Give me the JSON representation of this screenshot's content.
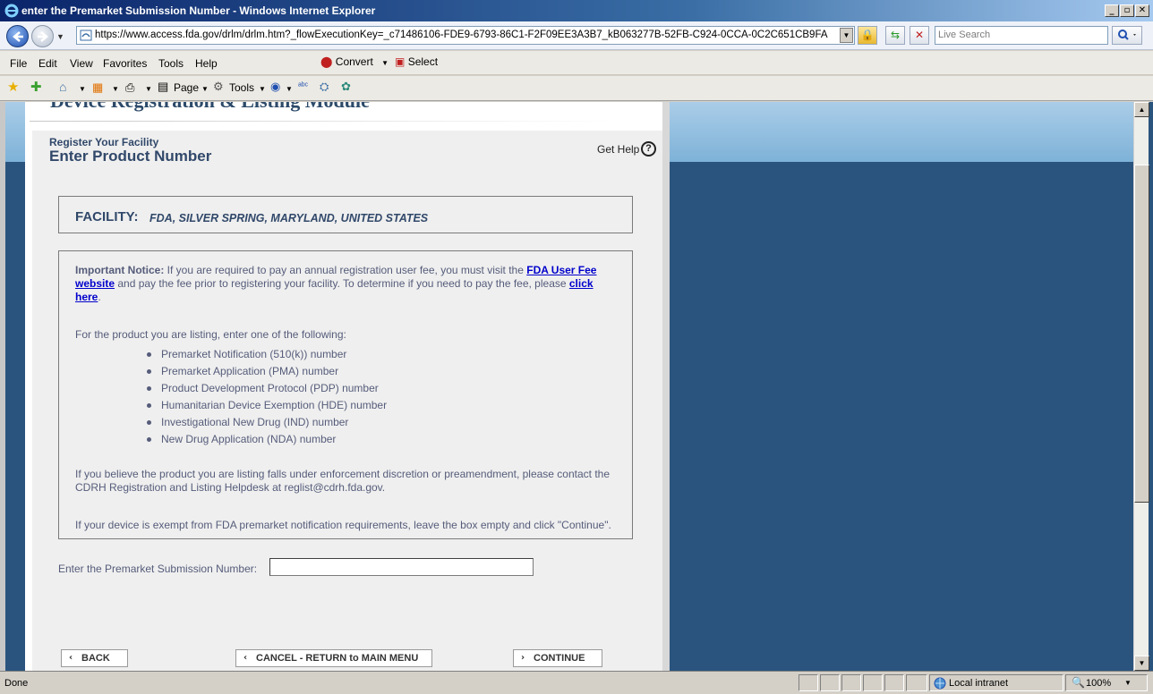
{
  "window": {
    "title": "enter the Premarket Submission Number - Windows Internet Explorer",
    "minimize": "_",
    "maximize": "▫",
    "close": "✕"
  },
  "address_bar": {
    "url": "https://www.access.fda.gov/drlm/drlm.htm?_flowExecutionKey=_c71486106-FDE9-6793-86C1-F2F09EE3A3B7_kB063277B-52FB-C924-0CCA-0C2C651CB9FA",
    "search_placeholder": "Live Search"
  },
  "menu": {
    "items": [
      "File",
      "Edit",
      "View",
      "Favorites",
      "Tools",
      "Help"
    ],
    "convert_label": "Convert",
    "select_label": "Select"
  },
  "command_bar": {
    "page_label": "Page",
    "tools_label": "Tools"
  },
  "page": {
    "cut_header": "Device Registration & Listing Module",
    "breadcrumb": "Register Your Facility",
    "title": "Enter Product Number",
    "get_help": "Get Help",
    "help_icon_glyph": "?",
    "facility": {
      "label": "FACILITY:",
      "value": "FDA, SILVER SPRING, MARYLAND, UNITED STATES"
    },
    "notice": {
      "heading": "Important Notice:",
      "line1_text": " If you are required to pay an annual registration user fee, you must visit the ",
      "user_fee_link_part1": "FDA User Fee",
      "user_fee_link_part2": "website",
      "line2_text": " and pay the fee prior to registering your facility. To determine if you need to pay the fee, please ",
      "click_here_part1": "click",
      "click_here_part2": "here",
      "period": ".",
      "intro": "For the product you are listing, enter one of the following:",
      "options": [
        "Premarket Notification (510(k)) number",
        "Premarket Application (PMA) number",
        "Product Development Protocol (PDP) number",
        "Humanitarian Device Exemption (HDE) number",
        "Investigational New Drug (IND) number",
        "New Drug Application (NDA) number"
      ],
      "enforcement_line1": "If you believe the product you are listing falls under enforcement discretion or preamendment, please contact the",
      "enforcement_line2": "CDRH Registration and Listing Helpdesk at reglist@cdrh.fda.gov.",
      "exempt_line": "If your device is exempt from FDA premarket notification requirements, leave the box empty and click \"Continue\"."
    },
    "submission_label": "Enter the Premarket Submission Number:",
    "submission_value": "",
    "buttons": {
      "back": "BACK",
      "cancel": "CANCEL - RETURN to MAIN MENU",
      "continue": "CONTINUE",
      "back_arrow": "‹",
      "forward_arrow": "›"
    }
  },
  "status_bar": {
    "status": "Done",
    "zone": "Local intranet",
    "zoom": "100%"
  }
}
